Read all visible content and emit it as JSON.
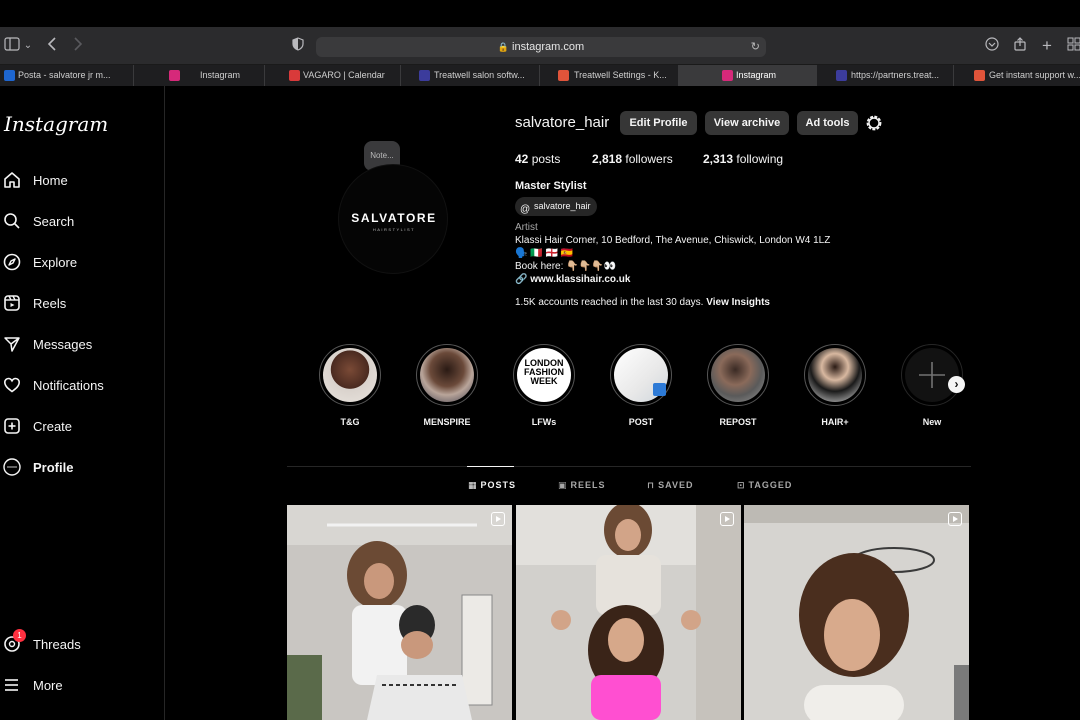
{
  "browser": {
    "url": "instagram.com",
    "tabs": [
      {
        "label": "Posta - salvatore jr m...",
        "fav": "#1e66d0"
      },
      {
        "label": "Instagram",
        "fav": "#d6297a"
      },
      {
        "label": "VAGARO | Calendar",
        "fav": "#d93a3a"
      },
      {
        "label": "Treatwell salon softw...",
        "fav": "#3c3c9c"
      },
      {
        "label": "Treatwell Settings - K...",
        "fav": "#e0543a"
      },
      {
        "label": "Instagram",
        "fav": "#d6297a",
        "active": true
      },
      {
        "label": "https://partners.treat...",
        "fav": "#3c3c9c"
      },
      {
        "label": "Get instant support w...",
        "fav": "#e0543a"
      }
    ]
  },
  "sidebar": {
    "logo": "Instagram",
    "items": [
      {
        "label": "Home",
        "icon": "home-icon"
      },
      {
        "label": "Search",
        "icon": "search-icon"
      },
      {
        "label": "Explore",
        "icon": "compass-icon"
      },
      {
        "label": "Reels",
        "icon": "reels-icon"
      },
      {
        "label": "Messages",
        "icon": "send-icon"
      },
      {
        "label": "Notifications",
        "icon": "heart-icon"
      },
      {
        "label": "Create",
        "icon": "plus-square-icon"
      },
      {
        "label": "Profile",
        "icon": "avatar-icon"
      }
    ],
    "threads": {
      "label": "Threads",
      "badge": "1"
    },
    "more": "More"
  },
  "profile": {
    "note": "Note...",
    "avatar_text": "SALVATORE",
    "avatar_sub": "HAIRSTYLIST",
    "username": "salvatore_hair",
    "buttons": {
      "edit": "Edit Profile",
      "archive": "View archive",
      "ad_tools": "Ad tools"
    },
    "stats": {
      "posts_count": "42",
      "posts_label": "posts",
      "followers_count": "2,818",
      "followers_label": "followers",
      "following_count": "2,313",
      "following_label": "following"
    },
    "full_name": "Master Stylist",
    "threads_handle": "salvatore_hair",
    "category": "Artist",
    "address": "Klassi Hair Corner, 10 Bedford, The Avenue, Chiswick, London W4 1LZ",
    "flags": "🗣️ 🇮🇹 🏴󠁧󠁢󠁥󠁮󠁧󠁿 🇪🇸",
    "book_here": "Book here: 👇🏼👇🏼👇🏼👀",
    "website": "www.klassihair.co.uk",
    "insights_text": "1.5K accounts reached in the last 30 days.",
    "insights_link": "View Insights"
  },
  "highlights": [
    {
      "label": "T&G"
    },
    {
      "label": "MENSPIRE"
    },
    {
      "label": "LFWs",
      "inner_text": "LONDON FASHION WEEK"
    },
    {
      "label": "POST"
    },
    {
      "label": "REPOST"
    },
    {
      "label": "HAIR+"
    },
    {
      "label": "New"
    }
  ],
  "profile_tabs": [
    {
      "label": "POSTS",
      "icon": "grid-icon",
      "active": true
    },
    {
      "label": "REELS",
      "icon": "reels-icon"
    },
    {
      "label": "SAVED",
      "icon": "bookmark-icon"
    },
    {
      "label": "TAGGED",
      "icon": "tag-icon"
    }
  ],
  "colors": {
    "accent": "#0095f6",
    "button": "#363636",
    "badge": "#ff3040"
  }
}
